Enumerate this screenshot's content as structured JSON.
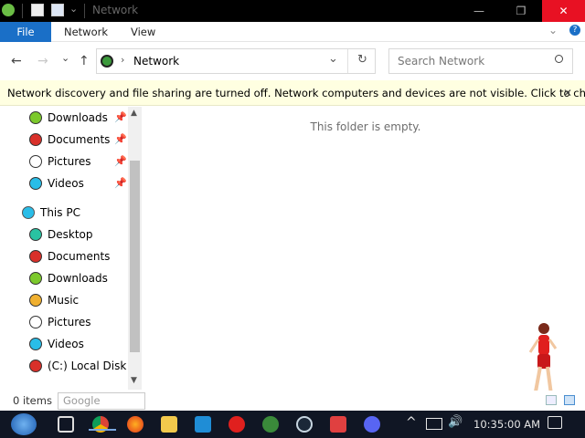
{
  "window": {
    "title": "Network",
    "controls": {
      "minimize": "—",
      "maximize": "❐",
      "close": "✕"
    }
  },
  "ribbon": {
    "tabs": [
      "File",
      "Network",
      "View"
    ],
    "expand_icon": "chevron-down-icon",
    "help_icon": "help-icon"
  },
  "nav": {
    "back": "←",
    "forward": "→",
    "recent": "⌄",
    "up": "↑",
    "address": "Network",
    "refresh": "↻",
    "dropdown": "⌄"
  },
  "search": {
    "placeholder": "Search Network"
  },
  "info_bar": {
    "text": "Network discovery and file sharing are turned off. Network computers and devices are not visible. Click to chan...",
    "close": "✕"
  },
  "sidebar": {
    "quick_access": [
      {
        "label": "Downloads",
        "color": "#7cc92c",
        "pinned": true
      },
      {
        "label": "Documents",
        "color": "#d9302a",
        "pinned": true
      },
      {
        "label": "Pictures",
        "color": "#ffffff",
        "pinned": true
      },
      {
        "label": "Videos",
        "color": "#29bde8",
        "pinned": true
      }
    ],
    "this_pc": {
      "label": "This PC",
      "color": "#29bde8"
    },
    "pc_items": [
      {
        "label": "Desktop",
        "color": "#29c3a2"
      },
      {
        "label": "Documents",
        "color": "#d9302a"
      },
      {
        "label": "Downloads",
        "color": "#7cc92c"
      },
      {
        "label": "Music",
        "color": "#f0b030"
      },
      {
        "label": "Pictures",
        "color": "#ffffff"
      },
      {
        "label": "Videos",
        "color": "#29bde8"
      },
      {
        "label": "(C:) Local Disk",
        "color": "#d9302a"
      }
    ]
  },
  "content": {
    "empty_text": "This folder is empty."
  },
  "status_bar": {
    "items_count": "0 items"
  },
  "tooltip": {
    "text": "Google Chrome"
  },
  "taskbar": {
    "clock": "10:35:00 AM",
    "apps": [
      "windows-start-icon",
      "task-view-icon",
      "chrome-icon",
      "firefox-icon",
      "file-explorer-icon",
      "vscode-icon",
      "opera-icon",
      "network-tool-icon",
      "steam-icon",
      "media-app-icon",
      "discord-icon"
    ],
    "tray": {
      "chevron": "^",
      "volume": "🔊",
      "notifications": "▭"
    }
  },
  "colors": {
    "accent": "#1a6fc7",
    "close_red": "#e81123",
    "info_bar_bg": "#ffffe1",
    "taskbar_bg": "#101624"
  }
}
